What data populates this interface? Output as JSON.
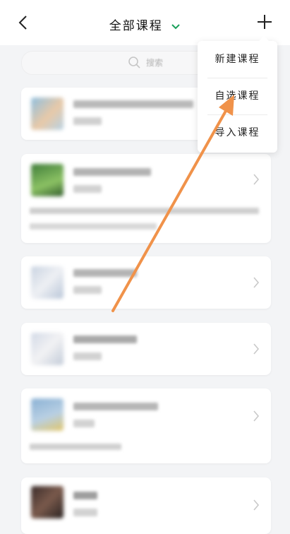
{
  "header": {
    "title": "全部课程",
    "back_icon": "chevron-left-icon",
    "add_icon": "plus-icon",
    "dropdown_icon": "chevron-down-icon",
    "accent_color": "#19a05a"
  },
  "search": {
    "placeholder": "搜索",
    "icon": "search-icon"
  },
  "menu": {
    "items": [
      {
        "label": "新建课程"
      },
      {
        "label": "自选课程"
      },
      {
        "label": "导入课程"
      }
    ]
  },
  "annotation": {
    "arrow_color": "#f0924a"
  }
}
